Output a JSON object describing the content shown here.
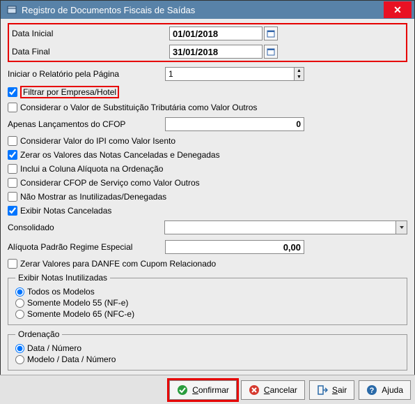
{
  "window": {
    "title": "Registro de Documentos Fiscais de Saídas"
  },
  "fields": {
    "dataInicial": {
      "label": "Data Inicial",
      "value": "01/01/2018"
    },
    "dataFinal": {
      "label": "Data Final",
      "value": "31/01/2018"
    },
    "pagina": {
      "label": "Iniciar o Relatório pela Página",
      "value": "1"
    },
    "cfop": {
      "label": "Apenas Lançamentos do CFOP",
      "value": "0"
    },
    "consolidado": {
      "label": "Consolidado",
      "value": ""
    },
    "aliquota": {
      "label": "Alíquota Padrão Regime Especial",
      "value": "0,00"
    }
  },
  "checkboxes": {
    "filtrarEmpresa": {
      "label": "Filtrar por Empresa/Hotel",
      "checked": true
    },
    "substTributaria": {
      "label": "Considerar o Valor de Substituição Tributária como Valor Outros",
      "checked": false
    },
    "ipiIsento": {
      "label": "Considerar Valor do IPI como Valor Isento",
      "checked": false
    },
    "zerarCanceladas": {
      "label": "Zerar os Valores das Notas Canceladas e Denegadas",
      "checked": true
    },
    "incluiAliquota": {
      "label": "Inclui a Coluna Alíquota na Ordenação",
      "checked": false
    },
    "cfopServico": {
      "label": "Considerar CFOP de Serviço como Valor Outros",
      "checked": false
    },
    "naoMostrarInut": {
      "label": "Não Mostrar as Inutilizadas/Denegadas",
      "checked": false
    },
    "exibirCanceladas": {
      "label": "Exibir Notas Canceladas",
      "checked": true
    },
    "zerarDanfe": {
      "label": "Zerar Valores para DANFE com Cupom Relacionado",
      "checked": false
    }
  },
  "groupInutilizadas": {
    "legend": "Exibir Notas Inutilizadas",
    "options": {
      "todos": "Todos os Modelos",
      "modelo55": "Somente Modelo 55 (NF-e)",
      "modelo65": "Somente Modelo 65 (NFC-e)"
    },
    "selected": "todos"
  },
  "groupOrdenacao": {
    "legend": "Ordenação",
    "options": {
      "dataNumero": "Data / Número",
      "modeloDataNumero": "Modelo / Data / Número"
    },
    "selected": "dataNumero"
  },
  "buttons": {
    "confirmar": "Confirmar",
    "cancelar": "Cancelar",
    "sair": "Sair",
    "ajuda": "Ajuda"
  }
}
